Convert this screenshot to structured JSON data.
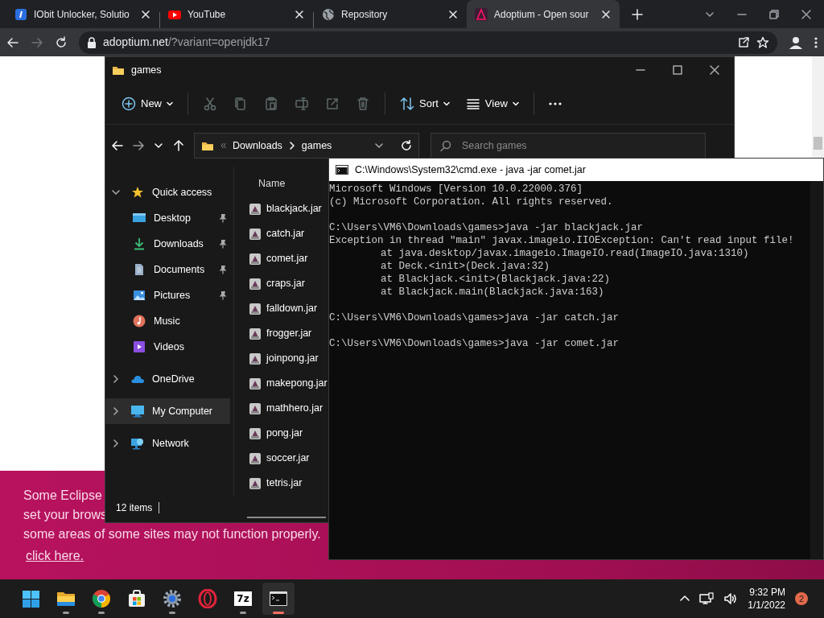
{
  "browser": {
    "tabs": [
      {
        "kind": "iobit",
        "title": "IObit Unlocker, Solutio",
        "selected": false
      },
      {
        "kind": "youtube",
        "title": "YouTube",
        "selected": false
      },
      {
        "kind": "globe",
        "title": "Repository",
        "selected": false
      },
      {
        "kind": "adoptium",
        "title": "Adoptium - Open sour",
        "selected": true
      }
    ],
    "url_domain": "adoptium.net",
    "url_path": "/?variant=openjdk17"
  },
  "page": {
    "banner_lines": [
      "Some Eclipse",
      "set your brows",
      "some areas of some sites may not function properly."
    ],
    "banner_link": "click here."
  },
  "explorer": {
    "title": "games",
    "toolbar": [
      {
        "kind": "new",
        "label": "New",
        "disabled": false
      },
      {
        "kind": "cut",
        "disabled": true
      },
      {
        "kind": "copy",
        "disabled": true
      },
      {
        "kind": "paste",
        "disabled": true
      },
      {
        "kind": "rename",
        "disabled": true
      },
      {
        "kind": "share",
        "disabled": true
      },
      {
        "kind": "delete",
        "disabled": true
      },
      {
        "kind": "sort",
        "label": "Sort",
        "disabled": false
      },
      {
        "kind": "view",
        "label": "View",
        "disabled": false
      },
      {
        "kind": "more",
        "disabled": false
      }
    ],
    "breadcrumb": [
      "Downloads",
      "games"
    ],
    "search_placeholder": "Search games",
    "nav": [
      {
        "kind": "star",
        "label": "Quick access",
        "expanded": true,
        "selected": false,
        "children": [
          {
            "kind": "desktop",
            "label": "Desktop",
            "pinned": true,
            "selected": false
          },
          {
            "kind": "download",
            "label": "Downloads",
            "pinned": true,
            "selected": false
          },
          {
            "kind": "documents",
            "label": "Documents",
            "pinned": true,
            "selected": false
          },
          {
            "kind": "pictures",
            "label": "Pictures",
            "pinned": true,
            "selected": false
          },
          {
            "kind": "music",
            "label": "Music",
            "pinned": false,
            "selected": false
          },
          {
            "kind": "videos",
            "label": "Videos",
            "pinned": false,
            "selected": false
          }
        ]
      },
      {
        "kind": "cloud",
        "label": "OneDrive",
        "expanded": false,
        "selected": false
      },
      {
        "kind": "computer",
        "label": "My Computer",
        "expanded": false,
        "selected": true
      },
      {
        "kind": "network",
        "label": "Network",
        "expanded": false,
        "selected": false
      }
    ],
    "column": "Name",
    "files": [
      "blackjack.jar",
      "catch.jar",
      "comet.jar",
      "craps.jar",
      "falldown.jar",
      "frogger.jar",
      "joinpong.jar",
      "makepong.jar",
      "mathhero.jar",
      "pong.jar",
      "soccer.jar",
      "tetris.jar"
    ],
    "status": "12 items"
  },
  "cmd": {
    "title": "C:\\Windows\\System32\\cmd.exe - java  -jar comet.jar",
    "lines": [
      {
        "kind": "text",
        "text": "Microsoft Windows [Version 10.0.22000.376]"
      },
      {
        "kind": "text",
        "text": "(c) Microsoft Corporation. All rights reserved."
      },
      {
        "kind": "blank"
      },
      {
        "kind": "text",
        "text": "C:\\Users\\VM6\\Downloads\\games>java -jar blackjack.jar"
      },
      {
        "kind": "text",
        "text": "Exception in thread \"main\" javax.imageio.IIOException: Can't read input file!"
      },
      {
        "kind": "trace",
        "text": "at java.desktop/javax.imageio.ImageIO.read(ImageIO.java:1310)"
      },
      {
        "kind": "trace",
        "text": "at Deck.<init>(Deck.java:32)"
      },
      {
        "kind": "trace",
        "text": "at Blackjack.<init>(Blackjack.java:22)"
      },
      {
        "kind": "trace",
        "text": "at Blackjack.main(Blackjack.java:163)"
      },
      {
        "kind": "blank"
      },
      {
        "kind": "text",
        "text": "C:\\Users\\VM6\\Downloads\\games>java -jar catch.jar"
      },
      {
        "kind": "blank"
      },
      {
        "kind": "text",
        "text": "C:\\Users\\VM6\\Downloads\\games>java -jar comet.jar"
      }
    ]
  },
  "taskbar": {
    "apps": [
      {
        "kind": "start",
        "running": false,
        "active": false
      },
      {
        "kind": "explorer",
        "running": true,
        "active": false
      },
      {
        "kind": "chrome",
        "running": true,
        "active": false
      },
      {
        "kind": "store",
        "running": false,
        "active": false
      },
      {
        "kind": "settings",
        "running": true,
        "active": false
      },
      {
        "kind": "opera",
        "running": false,
        "active": false
      },
      {
        "kind": "sevenzip",
        "label": "7z",
        "running": true,
        "active": false
      },
      {
        "kind": "terminal",
        "running": true,
        "active": true
      }
    ],
    "time": "9:32 PM",
    "date": "1/1/2022",
    "notifications": "2"
  }
}
